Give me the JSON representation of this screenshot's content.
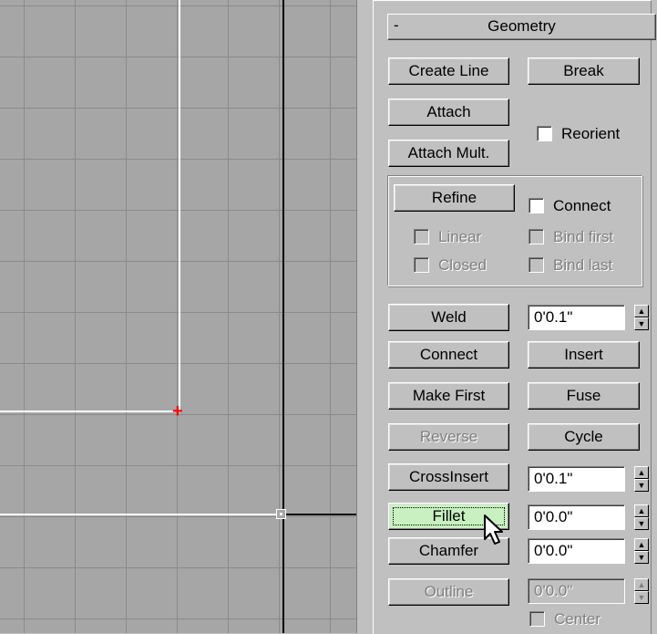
{
  "rollout": {
    "collapse_symbol": "-",
    "title": "Geometry"
  },
  "buttons": {
    "create_line": "Create Line",
    "break": "Break",
    "attach": "Attach",
    "attach_mult": "Attach Mult.",
    "refine": "Refine",
    "weld": "Weld",
    "connect": "Connect",
    "insert": "Insert",
    "make_first": "Make First",
    "fuse": "Fuse",
    "reverse": "Reverse",
    "cycle": "Cycle",
    "cross_insert": "CrossInsert",
    "fillet": "Fillet",
    "chamfer": "Chamfer",
    "outline": "Outline"
  },
  "checkboxes": {
    "reorient": "Reorient",
    "connect": "Connect",
    "linear": "Linear",
    "bind_first": "Bind first",
    "closed": "Closed",
    "bind_last": "Bind last",
    "center": "Center"
  },
  "spinners": {
    "weld_threshold": "0'0.1\"",
    "cross_insert": "0'0.1\"",
    "fillet": "0'0.0\"",
    "chamfer": "0'0.0\"",
    "outline": "0'0.0\""
  },
  "colors": {
    "active_button": "#c8f0c0",
    "vertex_marker": "#ff0000"
  },
  "icons": {
    "spinner_up": "▲",
    "spinner_down": "▼",
    "vertex_marker": "+"
  }
}
